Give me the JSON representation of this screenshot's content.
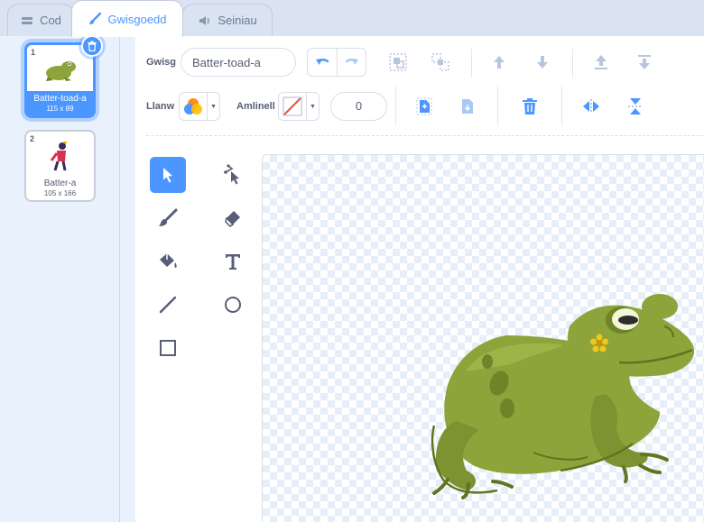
{
  "tabs": [
    {
      "label": "Cod",
      "icon": "code-icon"
    },
    {
      "label": "Gwisgoedd",
      "icon": "brush-icon"
    },
    {
      "label": "Seiniau",
      "icon": "speaker-icon"
    }
  ],
  "costumes": [
    {
      "number": "1",
      "name": "Batter-toad-a",
      "size": "115 x 89",
      "selected": true
    },
    {
      "number": "2",
      "name": "Batter-a",
      "size": "105 x 166",
      "selected": false
    }
  ],
  "editor": {
    "costume_label": "Gwisg",
    "costume_name": "Batter-toad-a",
    "fill_label": "Llanw",
    "outline_label": "Amlinell",
    "outline_width": "0"
  },
  "colors": {
    "accent": "#4c97ff",
    "frog": "#8ca43a",
    "frog_dark": "#5f7520"
  }
}
